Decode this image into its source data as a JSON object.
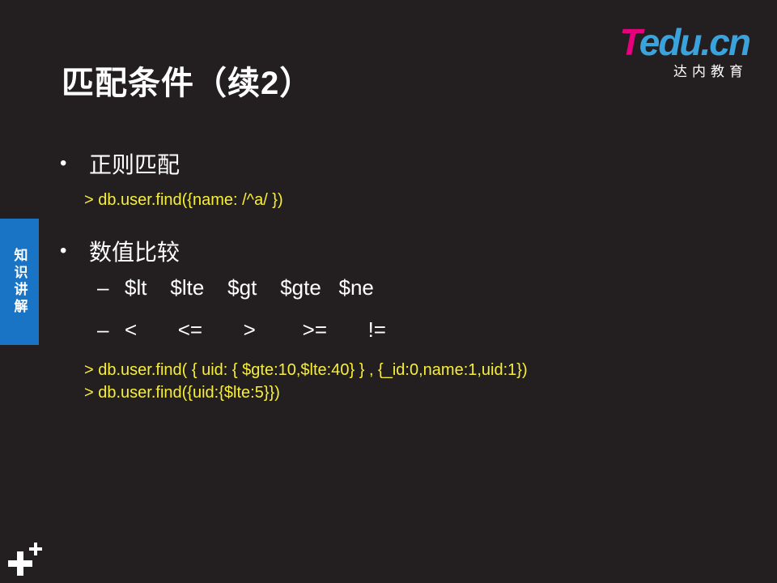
{
  "title": "匹配条件（续2）",
  "logo": {
    "brand_t": "T",
    "brand_rest": "edu.cn",
    "subtitle": "达内教育"
  },
  "side_tab": {
    "label": "知识讲解"
  },
  "sections": [
    {
      "bullet": "正则匹配",
      "commands": [
        "> db.user.find({name: /^a/ })"
      ]
    },
    {
      "bullet": "数值比较",
      "dash_items": [
        "$lt    $lte    $gt    $gte   $ne",
        "<       <=       >        >=       !="
      ],
      "commands": [
        "> db.user.find( { uid: { $gte:10,$lte:40} } , {_id:0,name:1,uid:1})",
        "> db.user.find({uid:{$lte:5}})"
      ]
    }
  ],
  "bullet_char": "•",
  "dash_char": "–",
  "colors": {
    "background": "#231f20",
    "command": "#f7ee37",
    "tab": "#1a74c6",
    "logo_magenta": "#e6007e",
    "logo_blue": "#3aa3dc"
  },
  "icons": {
    "corner": "plus-plus-icon"
  }
}
